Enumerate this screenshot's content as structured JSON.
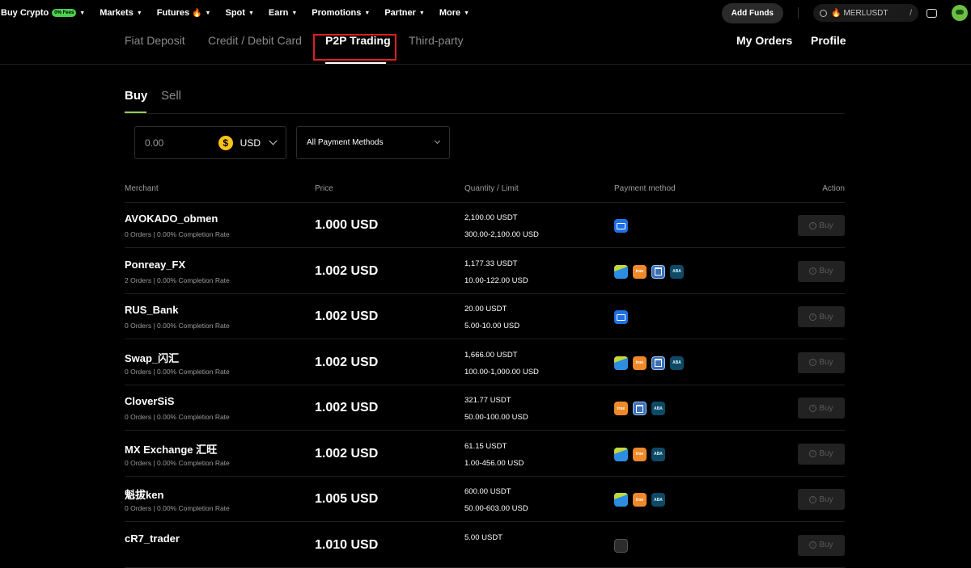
{
  "topnav": {
    "items": [
      {
        "label": "Buy Crypto",
        "badge": "0% Fees"
      },
      {
        "label": "Markets"
      },
      {
        "label": "Futures"
      },
      {
        "label": "Spot"
      },
      {
        "label": "Earn"
      },
      {
        "label": "Promotions"
      },
      {
        "label": "Partner"
      },
      {
        "label": "More"
      }
    ],
    "add_funds": "Add Funds",
    "search_value": "MERLUSDT",
    "search_shortcut": "/"
  },
  "subnav": {
    "tabs": [
      "Fiat Deposit",
      "Credit / Debit Card",
      "P2P Trading",
      "Third-party"
    ],
    "active_tab": "P2P Trading",
    "my_orders": "My Orders",
    "profile": "Profile"
  },
  "trade_tabs": {
    "buy": "Buy",
    "sell": "Sell",
    "active": "Buy"
  },
  "filters": {
    "amount": "0.00",
    "currency_symbol": "$",
    "currency": "USD",
    "payment_methods": "All Payment Methods"
  },
  "table": {
    "headers": {
      "merchant": "Merchant",
      "price": "Price",
      "quantity_limit": "Quantity / Limit",
      "payment_method": "Payment method",
      "action": "Action"
    },
    "action_label": "Buy",
    "rows": [
      {
        "merchant": "AVOKADO_obmen",
        "stats": "0 Orders | 0.00% Completion Rate",
        "price": "1.000 USD",
        "quantity": "2,100.00 USDT",
        "limit": "300.00-2,100.00 USD",
        "payments": [
          "card-icon"
        ]
      },
      {
        "merchant": "Ponreay_FX",
        "stats": "2 Orders | 0.00% Completion Rate",
        "price": "1.002 USD",
        "quantity": "1,177.33 USDT",
        "limit": "10.00-122.00 USD",
        "payments": [
          "bank-transfer-icon",
          "truemoney-icon",
          "bank-building-icon",
          "aba-icon"
        ]
      },
      {
        "merchant": "RUS_Bank",
        "stats": "0 Orders | 0.00% Completion Rate",
        "price": "1.002 USD",
        "quantity": "20.00 USDT",
        "limit": "5.00-10.00 USD",
        "payments": [
          "card-icon"
        ]
      },
      {
        "merchant": "Swap_闪汇",
        "stats": "0 Orders | 0.00% Completion Rate",
        "price": "1.002 USD",
        "quantity": "1,666.00 USDT",
        "limit": "100.00-1,000.00 USD",
        "payments": [
          "bank-transfer-icon",
          "truemoney-icon",
          "bank-building-icon",
          "aba-icon"
        ]
      },
      {
        "merchant": "CloverSiS",
        "stats": "0 Orders | 0.00% Completion Rate",
        "price": "1.002 USD",
        "quantity": "321.77 USDT",
        "limit": "50.00-100.00 USD",
        "payments": [
          "truemoney-icon",
          "bank-building-icon",
          "aba-icon"
        ]
      },
      {
        "merchant": "MX Exchange 汇旺",
        "stats": "0 Orders | 0.00% Completion Rate",
        "price": "1.002 USD",
        "quantity": "61.15 USDT",
        "limit": "1.00-456.00 USD",
        "payments": [
          "bank-transfer-icon",
          "truemoney-icon",
          "aba-icon"
        ]
      },
      {
        "merchant": "魁拔ken",
        "stats": "0 Orders | 0.00% Completion Rate",
        "price": "1.005 USD",
        "quantity": "600.00 USDT",
        "limit": "50.00-603.00 USD",
        "payments": [
          "bank-transfer-icon",
          "truemoney-icon",
          "aba-icon"
        ]
      },
      {
        "merchant": "cR7_trader",
        "stats": "",
        "price": "1.010 USD",
        "quantity": "5.00 USDT",
        "limit": "",
        "payments": [
          "dark-wallet-icon"
        ]
      }
    ]
  },
  "colors": {
    "accent_green": "#8fd14f",
    "highlight_red": "#e01e1e",
    "background": "#000000"
  }
}
